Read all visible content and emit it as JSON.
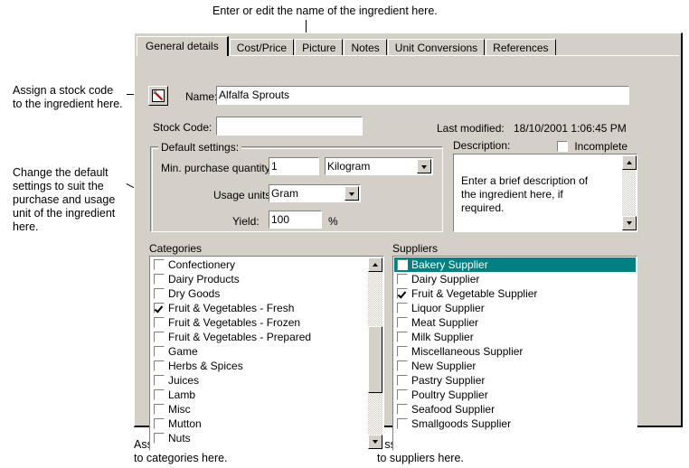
{
  "annotations": {
    "top_name": "Enter or edit the name of the ingredient here.",
    "stock_code": "Assign a stock code\nto the ingredient here.",
    "default_settings": "Change the default\nsettings to suit the\npurchase and usage\nunit of the ingredient\nhere.",
    "categories": "Assign the ingredient\nto categories here.",
    "suppliers": "Assign the ingredient\nto suppliers here."
  },
  "dialog": {
    "tabs": [
      {
        "label": "General details",
        "active": true
      },
      {
        "label": "Cost/Price",
        "active": false
      },
      {
        "label": "Picture",
        "active": false
      },
      {
        "label": "Notes",
        "active": false
      },
      {
        "label": "Unit Conversions",
        "active": false
      },
      {
        "label": "References",
        "active": false
      }
    ],
    "name": {
      "icon": "edit-pencil-icon",
      "label": "Name:",
      "value": "Alfalfa Sprouts"
    },
    "stock_code": {
      "label": "Stock Code:",
      "value": ""
    },
    "last_modified": {
      "label": "Last modified:",
      "value": "18/10/2001 1:06:45 PM"
    },
    "incomplete": {
      "label": "Incomplete",
      "checked": false
    },
    "default_settings": {
      "title": "Default settings:",
      "min_purchase_quantity": {
        "label": "Min. purchase quantity:",
        "value": "1",
        "unit": "Kilogram"
      },
      "usage_units": {
        "label": "Usage units:",
        "value": "Gram"
      },
      "yield": {
        "label": "Yield:",
        "value": "100",
        "suffix": "%"
      }
    },
    "description": {
      "label": "Description:",
      "value": "Enter a brief description of the\ningredient here, if required."
    },
    "categories": {
      "label": "Categories",
      "items": [
        {
          "label": "Confectionery",
          "checked": false,
          "selected": false
        },
        {
          "label": "Dairy Products",
          "checked": false,
          "selected": false
        },
        {
          "label": "Dry Goods",
          "checked": false,
          "selected": false
        },
        {
          "label": "Fruit & Vegetables - Fresh",
          "checked": true,
          "selected": false
        },
        {
          "label": "Fruit & Vegetables - Frozen",
          "checked": false,
          "selected": false
        },
        {
          "label": "Fruit & Vegetables - Prepared",
          "checked": false,
          "selected": false
        },
        {
          "label": "Game",
          "checked": false,
          "selected": false
        },
        {
          "label": "Herbs & Spices",
          "checked": false,
          "selected": false
        },
        {
          "label": "Juices",
          "checked": false,
          "selected": false
        },
        {
          "label": "Lamb",
          "checked": false,
          "selected": false
        },
        {
          "label": "Misc",
          "checked": false,
          "selected": false
        },
        {
          "label": "Mutton",
          "checked": false,
          "selected": false
        },
        {
          "label": "Nuts",
          "checked": false,
          "selected": false
        }
      ]
    },
    "suppliers": {
      "label": "Suppliers",
      "items": [
        {
          "label": "Bakery Supplier",
          "checked": false,
          "selected": true
        },
        {
          "label": "Dairy Supplier",
          "checked": false,
          "selected": false
        },
        {
          "label": "Fruit & Vegetable Supplier",
          "checked": true,
          "selected": false
        },
        {
          "label": "Liquor Supplier",
          "checked": false,
          "selected": false
        },
        {
          "label": "Meat Supplier",
          "checked": false,
          "selected": false
        },
        {
          "label": "Milk Supplier",
          "checked": false,
          "selected": false
        },
        {
          "label": "Miscellaneous Supplier",
          "checked": false,
          "selected": false
        },
        {
          "label": "New Supplier",
          "checked": false,
          "selected": false
        },
        {
          "label": "Pastry Supplier",
          "checked": false,
          "selected": false
        },
        {
          "label": "Poultry Supplier",
          "checked": false,
          "selected": false
        },
        {
          "label": "Seafood Supplier",
          "checked": false,
          "selected": false
        },
        {
          "label": "Smallgoods Supplier",
          "checked": false,
          "selected": false
        }
      ]
    }
  },
  "colors": {
    "dialog_face": "#d4d0c8",
    "selection": "#008080",
    "field": "#ffffff",
    "accent_red": "#cc0000"
  }
}
